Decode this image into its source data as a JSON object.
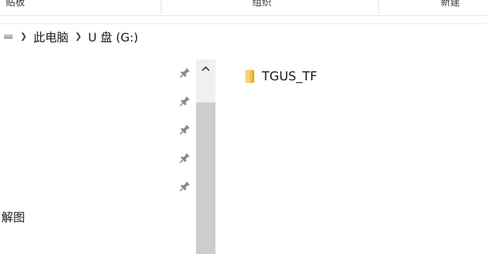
{
  "ribbon": {
    "groups": [
      "贴板",
      "组织",
      "新建"
    ]
  },
  "address": {
    "segments": [
      "此电脑",
      "U 盘 (G:)"
    ]
  },
  "nav": {
    "partial_label": "解图"
  },
  "files": [
    {
      "name": "TGUS_TF",
      "type": "folder-icon"
    }
  ],
  "colors": {
    "folder": "#f2c14e",
    "scroll_thumb": "#cdcdcd",
    "scroll_track": "#f0f0f0",
    "pin": "#8a8a8a"
  }
}
